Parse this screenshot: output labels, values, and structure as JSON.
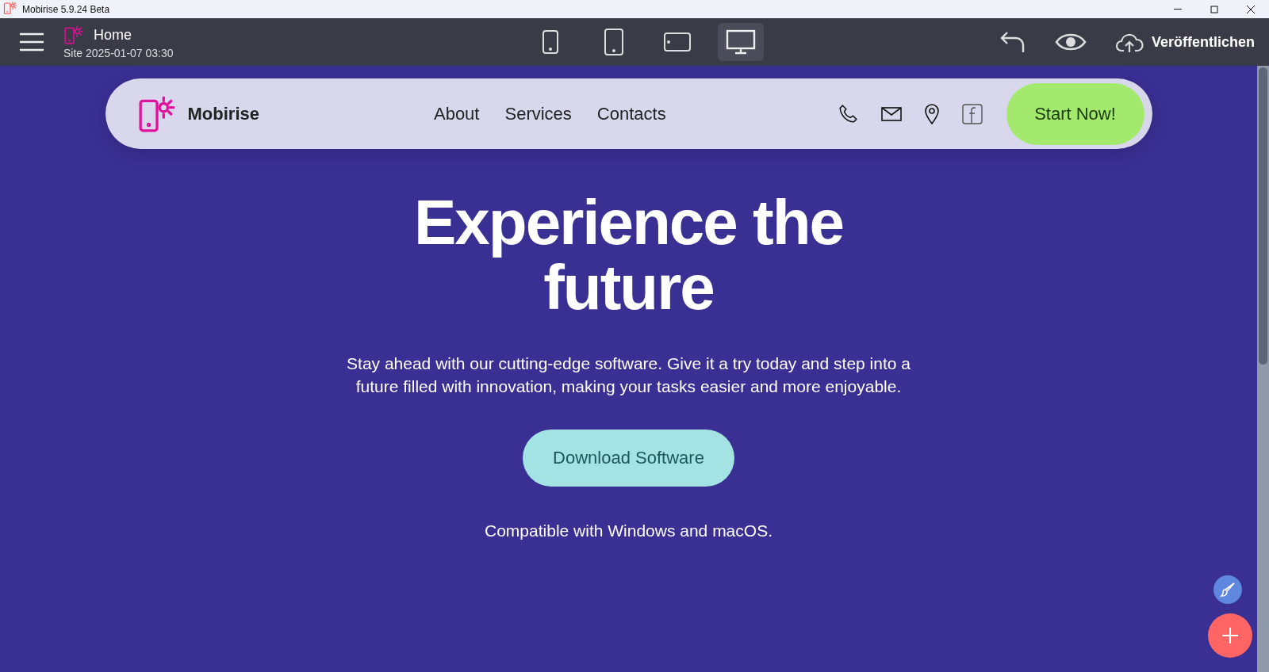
{
  "window": {
    "title": "Mobirise 5.9.24 Beta"
  },
  "toolbar": {
    "page_title": "Home",
    "site_label": "Site 2025-01-07 03:30",
    "devices": [
      {
        "kind": "phone",
        "selected": false
      },
      {
        "kind": "tablet",
        "selected": false
      },
      {
        "kind": "landscape",
        "selected": false
      },
      {
        "kind": "desktop",
        "selected": true
      }
    ],
    "publish_label": "Veröffentlichen"
  },
  "site": {
    "brand": "Mobirise",
    "nav": [
      "About",
      "Services",
      "Contacts"
    ],
    "cta": "Start Now!",
    "headline": "Experience the future",
    "text": "Stay ahead with our cutting-edge software. Give it a try today and step into a future filled with innovation, making your tasks easier and more enjoyable.",
    "button": "Download Software",
    "note": "Compatible with Windows and macOS."
  }
}
